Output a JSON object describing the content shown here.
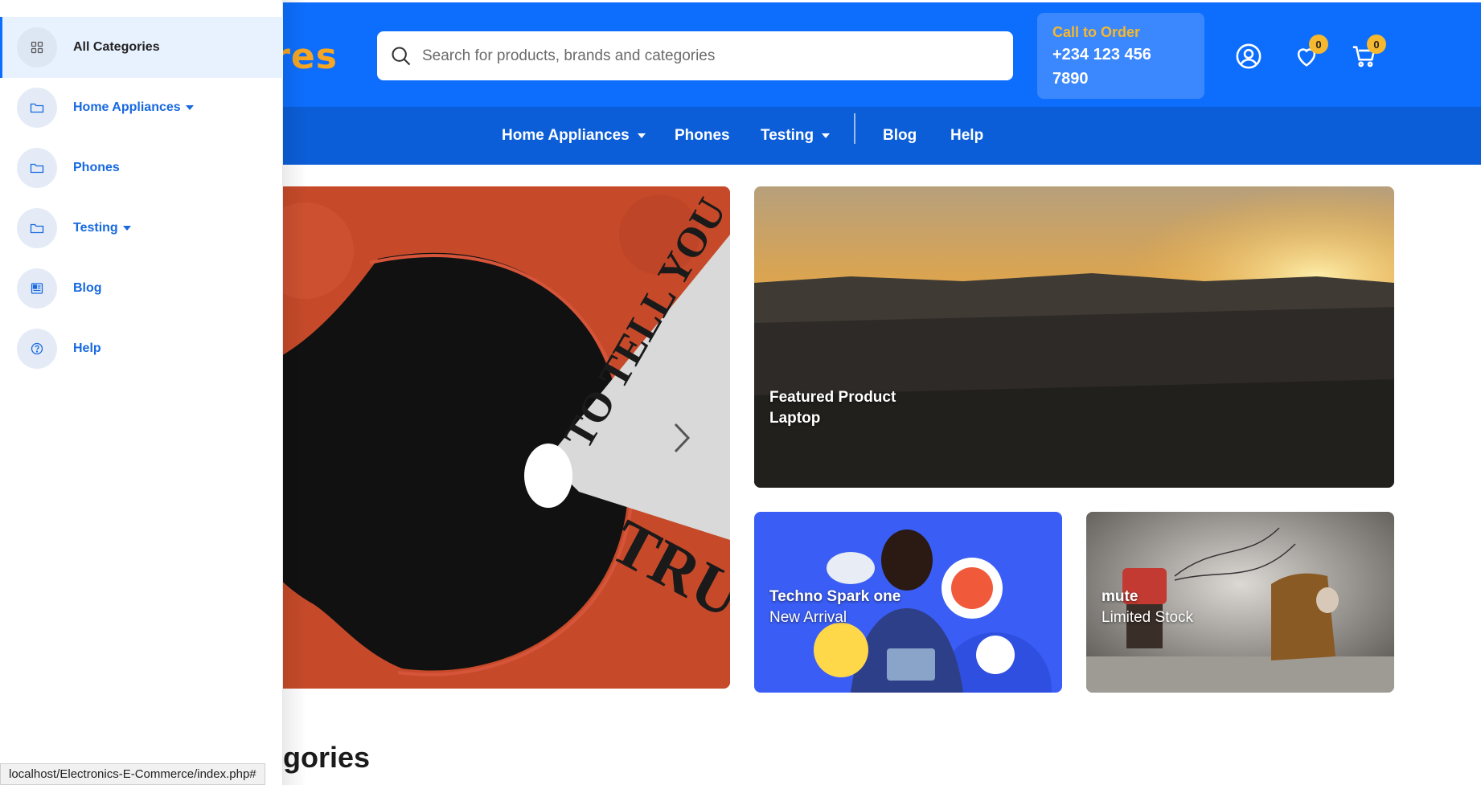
{
  "header": {
    "logo_partial": "ores",
    "search_placeholder": "Search for products, brands and categories",
    "order_title": "Call to Order",
    "order_phone": "+234 123 456 7890",
    "wishlist_count": "0",
    "cart_count": "0"
  },
  "nav": {
    "items": [
      {
        "label": "Home Appliances"
      },
      {
        "label": "Phones"
      },
      {
        "label": "Testing"
      },
      {
        "label": "Blog"
      },
      {
        "label": "Help"
      }
    ]
  },
  "banners": {
    "featured_title": "Featured Product",
    "featured_sub": "Laptop",
    "techno_title": "Techno Spark one",
    "techno_sub": "New Arrival",
    "mute_title": "mute",
    "mute_sub": "Limited Stock"
  },
  "section": {
    "title_partial": "gories"
  },
  "sidebar": {
    "items": [
      {
        "label": "All Categories",
        "icon": "grid-icon"
      },
      {
        "label": "Home Appliances",
        "icon": "folder-icon"
      },
      {
        "label": "Phones",
        "icon": "folder-icon"
      },
      {
        "label": "Testing",
        "icon": "folder-icon"
      },
      {
        "label": "Blog",
        "icon": "newspaper-icon"
      },
      {
        "label": "Help",
        "icon": "help-circle-icon"
      }
    ]
  },
  "status_url": "localhost/Electronics-E-Commerce/index.php#",
  "colors": {
    "primary": "#0d6efd",
    "nav": "#0b5ed7",
    "accent": "#f5a623"
  }
}
